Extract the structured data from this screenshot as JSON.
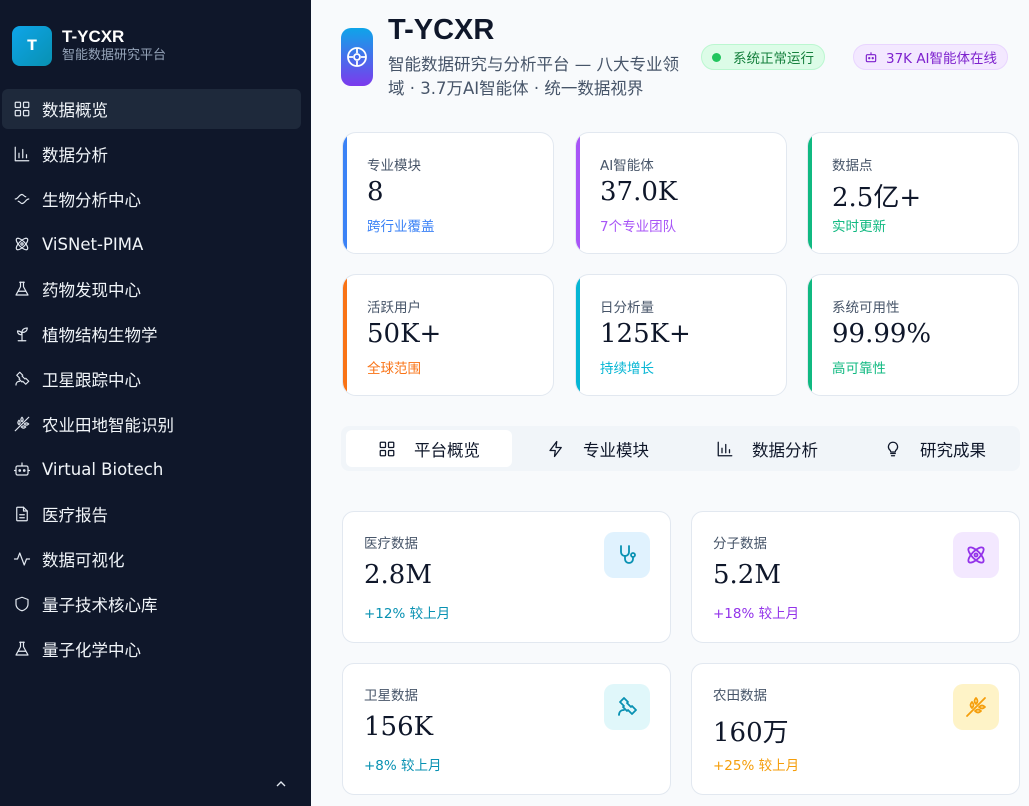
{
  "brand": {
    "logo_letter": "T",
    "name": "T-YCXR",
    "subtitle": "智能数据研究平台"
  },
  "sidebar": {
    "items": [
      {
        "label": "数据概览",
        "icon": "grid-icon",
        "active": true
      },
      {
        "label": "数据分析",
        "icon": "bar-chart-icon"
      },
      {
        "label": "生物分析中心",
        "icon": "dna-icon"
      },
      {
        "label": "ViSNet-PIMA",
        "icon": "atom-icon"
      },
      {
        "label": "药物发现中心",
        "icon": "flask-icon"
      },
      {
        "label": "植物结构生物学",
        "icon": "sprout-icon"
      },
      {
        "label": "卫星跟踪中心",
        "icon": "satellite-icon"
      },
      {
        "label": "农业田地智能识别",
        "icon": "wheat-icon"
      },
      {
        "label": "Virtual Biotech",
        "icon": "bot-icon"
      },
      {
        "label": "医疗报告",
        "icon": "document-icon"
      },
      {
        "label": "数据可视化",
        "icon": "activity-icon"
      },
      {
        "label": "量子技术核心库",
        "icon": "shield-icon"
      },
      {
        "label": "量子化学中心",
        "icon": "flask-icon"
      }
    ]
  },
  "header": {
    "title": "T-YCXR",
    "description": "智能数据研究与分析平台 — 八大专业领域 · 3.7万AI智能体 · 统一数据视界",
    "status_badge": "系统正常运行",
    "ai_badge": "37K AI智能体在线"
  },
  "stats": [
    {
      "label": "专业模块",
      "value": "8",
      "sub": "跨行业覆盖",
      "color": "#3b82f6"
    },
    {
      "label": "AI智能体",
      "value": "37.0K",
      "sub": "7个专业团队",
      "color": "#a855f7"
    },
    {
      "label": "数据点",
      "value": "2.5亿+",
      "sub": "实时更新",
      "color": "#10b981"
    },
    {
      "label": "活跃用户",
      "value": "50K+",
      "sub": "全球范围",
      "color": "#f97316"
    },
    {
      "label": "日分析量",
      "value": "125K+",
      "sub": "持续增长",
      "color": "#06b6d4"
    },
    {
      "label": "系统可用性",
      "value": "99.99%",
      "sub": "高可靠性",
      "color": "#10b981"
    }
  ],
  "tabs": [
    {
      "label": "平台概览",
      "icon": "grid-icon",
      "active": true
    },
    {
      "label": "专业模块",
      "icon": "zap-icon"
    },
    {
      "label": "数据分析",
      "icon": "bar-chart-icon"
    },
    {
      "label": "研究成果",
      "icon": "lightbulb-icon"
    }
  ],
  "cards": [
    {
      "label": "医疗数据",
      "value": "2.8M",
      "change": "+12% 较上月",
      "icon": "stethoscope-icon",
      "color": "#0891b2",
      "bg": "#e0f2fe"
    },
    {
      "label": "分子数据",
      "value": "5.2M",
      "change": "+18% 较上月",
      "icon": "atom-icon",
      "color": "#9333ea",
      "bg": "#f3e8ff"
    },
    {
      "label": "卫星数据",
      "value": "156K",
      "change": "+8% 较上月",
      "icon": "satellite-icon",
      "color": "#0891b2",
      "bg": "#e0f7fa"
    },
    {
      "label": "农田数据",
      "value": "160万",
      "change": "+25% 较上月",
      "icon": "wheat-icon",
      "color": "#f59e0b",
      "bg": "#fef3c7"
    }
  ]
}
